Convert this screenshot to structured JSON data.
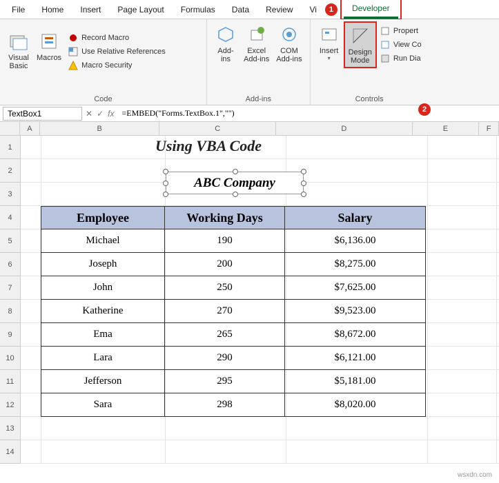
{
  "tabs": {
    "file": "File",
    "home": "Home",
    "insert": "Insert",
    "pagelayout": "Page Layout",
    "formulas": "Formulas",
    "data": "Data",
    "review": "Review",
    "view_trunc": "Vi",
    "developer": "Developer"
  },
  "callouts": {
    "one": "1",
    "two": "2"
  },
  "ribbon": {
    "code": {
      "vb": "Visual\nBasic",
      "macros": "Macros",
      "record": "Record Macro",
      "relref": "Use Relative References",
      "security": "Macro Security",
      "group": "Code"
    },
    "addins": {
      "addins": "Add-\nins",
      "excel": "Excel\nAdd-ins",
      "com": "COM\nAdd-ins",
      "group": "Add-ins"
    },
    "controls": {
      "insert": "Insert",
      "design": "Design\nMode",
      "props": "Propert",
      "viewcode": "View Co",
      "rundlg": "Run Dia",
      "group": "Controls"
    }
  },
  "namebox": "TextBox1",
  "formula": "=EMBED(\"Forms.TextBox.1\",\"\")",
  "fx": "fx",
  "cols": {
    "A": "A",
    "B": "B",
    "C": "C",
    "D": "D",
    "E": "E",
    "F": "F"
  },
  "title": "Using VBA Code",
  "textbox": "ABC Company",
  "chart_data": {
    "type": "table",
    "columns": [
      "Employee",
      "Working Days",
      "Salary"
    ],
    "rows": [
      {
        "employee": "Michael",
        "days": "190",
        "salary": "$6,136.00"
      },
      {
        "employee": "Joseph",
        "days": "200",
        "salary": "$8,275.00"
      },
      {
        "employee": "John",
        "days": "250",
        "salary": "$7,625.00"
      },
      {
        "employee": "Katherine",
        "days": "270",
        "salary": "$9,523.00"
      },
      {
        "employee": "Ema",
        "days": "265",
        "salary": "$8,672.00"
      },
      {
        "employee": "Lara",
        "days": "290",
        "salary": "$6,121.00"
      },
      {
        "employee": "Jefferson",
        "days": "295",
        "salary": "$5,181.00"
      },
      {
        "employee": "Sara",
        "days": "298",
        "salary": "$8,020.00"
      }
    ]
  },
  "watermark": "wsxdn.com"
}
